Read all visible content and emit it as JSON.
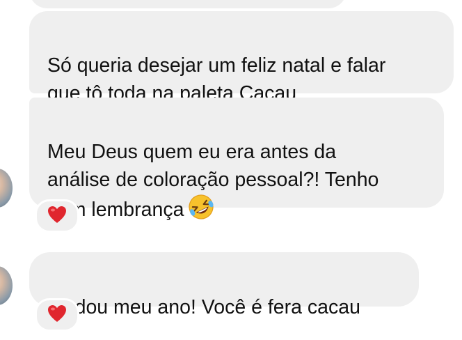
{
  "messages": [
    {
      "text": ""
    },
    {
      "text": "Só queria desejar um feliz natal e falar\nque tô toda na paleta Cacau"
    },
    {
      "text": "Meu Deus quem eu era antes da\nanálise de coloração pessoal?! Tenho\nnem lembrança",
      "emoji": "rolling-on-floor-laughing"
    },
    {
      "text": "Mudou meu ano! Você é fera cacau"
    }
  ],
  "reactions": [
    {
      "emoji": "red-heart",
      "count": 1,
      "on_message": 2
    },
    {
      "emoji": "red-heart",
      "count": 1,
      "on_message": 3
    }
  ],
  "colors": {
    "bubble_background": "#efefef",
    "text": "#111111",
    "heart": "#e0262e",
    "page_background": "#ffffff"
  }
}
